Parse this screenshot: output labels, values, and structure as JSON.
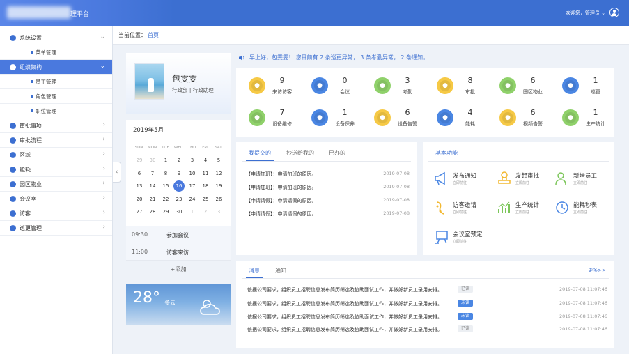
{
  "header": {
    "app_title": "理平台",
    "welcome_text": "欢迎您，管理员"
  },
  "sidebar": {
    "items": [
      {
        "label": "系统设置",
        "icon": "settings-icon"
      },
      {
        "label": "菜单管理",
        "sub": true
      },
      {
        "label": "组织架构",
        "icon": "org-chart-icon",
        "active": true
      },
      {
        "label": "员工管理",
        "sub": true
      },
      {
        "label": "角色管理",
        "sub": true
      },
      {
        "label": "职位管理",
        "sub": true
      },
      {
        "label": "审批事项",
        "icon": "user-icon"
      },
      {
        "label": "审批流程",
        "icon": "flow-icon"
      },
      {
        "label": "区域",
        "icon": "location-icon"
      },
      {
        "label": "能耗",
        "icon": "energy-icon"
      },
      {
        "label": "园区物业",
        "icon": "building-icon"
      },
      {
        "label": "会议室",
        "icon": "meeting-icon"
      },
      {
        "label": "访客",
        "icon": "visitor-icon"
      },
      {
        "label": "巡更管理",
        "icon": "patrol-icon"
      }
    ]
  },
  "breadcrumb": {
    "label": "当前位置：",
    "current": "首页"
  },
  "profile": {
    "name": "包雯雯",
    "dept": "行政部 | 行政助理"
  },
  "calendar": {
    "title": "2019年5月",
    "weekdays": [
      "SUN",
      "MON",
      "TUE",
      "WED",
      "THU",
      "FRI",
      "SAT"
    ],
    "weeks": [
      [
        "29",
        "30",
        "1",
        "2",
        "3",
        "4",
        "5"
      ],
      [
        "6",
        "7",
        "8",
        "9",
        "10",
        "11",
        "12"
      ],
      [
        "13",
        "14",
        "15",
        "16",
        "17",
        "18",
        "19"
      ],
      [
        "20",
        "21",
        "22",
        "23",
        "24",
        "25",
        "26"
      ],
      [
        "27",
        "28",
        "29",
        "30",
        "1",
        "2",
        "3"
      ]
    ],
    "today": "16",
    "schedule": [
      {
        "time": "09:30",
        "event": "参加会议"
      },
      {
        "time": "11:00",
        "event": "访客来访"
      }
    ],
    "add_label": "+添加"
  },
  "weather": {
    "temp": "28°",
    "desc": "多云"
  },
  "notice": "早上好，包雯雯！ 您目前有 2 条巡更异常， 3 条考勤异常， 2 条通知。",
  "stats": [
    {
      "num": "9",
      "label": "来访访客",
      "color": "#f6c945",
      "icon": "visitor-icon"
    },
    {
      "num": "0",
      "label": "会议",
      "color": "#4a86e3",
      "icon": "meeting-icon"
    },
    {
      "num": "3",
      "label": "考勤",
      "color": "#8fd16a",
      "icon": "attendance-icon"
    },
    {
      "num": "8",
      "label": "审批",
      "color": "#f6c945",
      "icon": "approval-icon"
    },
    {
      "num": "6",
      "label": "园区物业",
      "color": "#8fd16a",
      "icon": "building-icon"
    },
    {
      "num": "1",
      "label": "巡更",
      "color": "#4a86e3",
      "icon": "patrol-icon"
    },
    {
      "num": "7",
      "label": "设备维修",
      "color": "#8fd16a",
      "icon": "repair-icon"
    },
    {
      "num": "1",
      "label": "设备保养",
      "color": "#4a86e3",
      "icon": "maintenance-icon"
    },
    {
      "num": "6",
      "label": "设备告警",
      "color": "#f6c945",
      "icon": "alarm-icon"
    },
    {
      "num": "4",
      "label": "能耗",
      "color": "#4a86e3",
      "icon": "energy-icon"
    },
    {
      "num": "6",
      "label": "视频告警",
      "color": "#f6c945",
      "icon": "video-icon"
    },
    {
      "num": "1",
      "label": "生产统计",
      "color": "#8fd16a",
      "icon": "stats-icon"
    }
  ],
  "tasks": {
    "tabs": [
      "我提交的",
      "抄送给我的",
      "已办的"
    ],
    "items": [
      {
        "text": "【申请加班】：申请加班的原因。",
        "date": "2019-07-08"
      },
      {
        "text": "【申请加班】：申请加班的原因。",
        "date": "2019-07-08"
      },
      {
        "text": "【申请请假】：申请请假的原因。",
        "date": "2019-07-08"
      },
      {
        "text": "【申请请假】：申请请假的原因。",
        "date": "2019-07-08"
      }
    ]
  },
  "functions": {
    "title": "基本功能",
    "items": [
      {
        "name": "发布通知",
        "sub": "立即前往",
        "icon": "megaphone-icon"
      },
      {
        "name": "发起审批",
        "sub": "立即前往",
        "icon": "stamp-icon"
      },
      {
        "name": "新增员工",
        "sub": "立即前往",
        "icon": "add-user-icon"
      },
      {
        "name": "访客邀请",
        "sub": "立即前往",
        "icon": "invite-icon"
      },
      {
        "name": "生产统计",
        "sub": "立即前往",
        "icon": "chart-icon"
      },
      {
        "name": "能耗秒表",
        "sub": "立即前往",
        "icon": "clock-icon"
      },
      {
        "name": "会议室预定",
        "sub": "立即前往",
        "icon": "projector-icon"
      }
    ]
  },
  "messages": {
    "tabs": [
      "消息",
      "通知"
    ],
    "more": "更多>>",
    "items": [
      {
        "text": "依据公司要求，组织员工招聘信息发布简历筛选及协助面试工作，并做好新员工录用安排。",
        "status": "已读",
        "unread": false,
        "date": "2019-07-08  11:07:46"
      },
      {
        "text": "依据公司要求，组织员工招聘信息发布简历筛选及协助面试工作，并做好新员工录用安排。",
        "status": "未读",
        "unread": true,
        "date": "2019-07-08  11:07:46"
      },
      {
        "text": "依据公司要求，组织员工招聘信息发布简历筛选及协助面试工作，并做好新员工录用安排。",
        "status": "未读",
        "unread": true,
        "date": "2019-07-08  11:07:46"
      },
      {
        "text": "依据公司要求，组织员工招聘信息发布简历筛选及协助面试工作，并做好新员工录用安排。",
        "status": "已读",
        "unread": false,
        "date": "2019-07-08  11:07:46"
      }
    ]
  }
}
